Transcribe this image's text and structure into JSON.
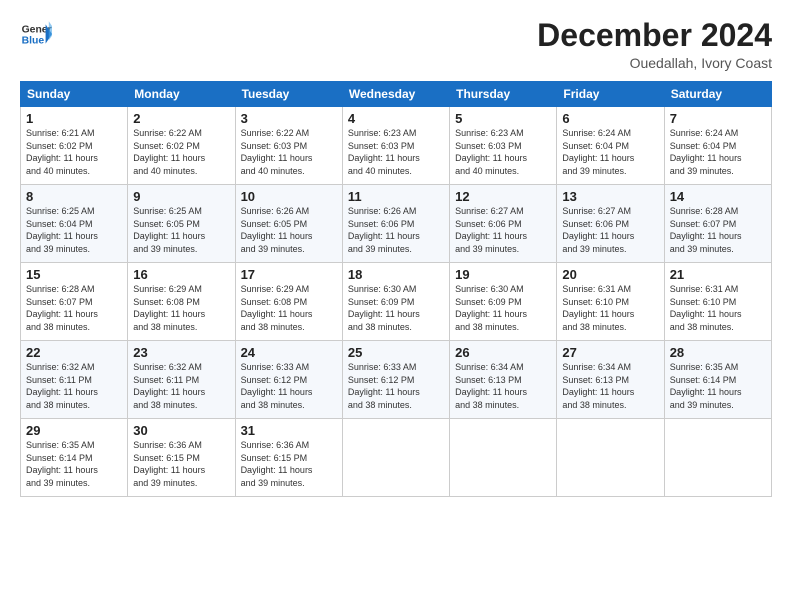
{
  "logo": {
    "line1": "General",
    "line2": "Blue"
  },
  "title": "December 2024",
  "subtitle": "Ouedallah, Ivory Coast",
  "header_days": [
    "Sunday",
    "Monday",
    "Tuesday",
    "Wednesday",
    "Thursday",
    "Friday",
    "Saturday"
  ],
  "weeks": [
    [
      {
        "day": "1",
        "lines": [
          "Sunrise: 6:21 AM",
          "Sunset: 6:02 PM",
          "Daylight: 11 hours",
          "and 40 minutes."
        ]
      },
      {
        "day": "2",
        "lines": [
          "Sunrise: 6:22 AM",
          "Sunset: 6:02 PM",
          "Daylight: 11 hours",
          "and 40 minutes."
        ]
      },
      {
        "day": "3",
        "lines": [
          "Sunrise: 6:22 AM",
          "Sunset: 6:03 PM",
          "Daylight: 11 hours",
          "and 40 minutes."
        ]
      },
      {
        "day": "4",
        "lines": [
          "Sunrise: 6:23 AM",
          "Sunset: 6:03 PM",
          "Daylight: 11 hours",
          "and 40 minutes."
        ]
      },
      {
        "day": "5",
        "lines": [
          "Sunrise: 6:23 AM",
          "Sunset: 6:03 PM",
          "Daylight: 11 hours",
          "and 40 minutes."
        ]
      },
      {
        "day": "6",
        "lines": [
          "Sunrise: 6:24 AM",
          "Sunset: 6:04 PM",
          "Daylight: 11 hours",
          "and 39 minutes."
        ]
      },
      {
        "day": "7",
        "lines": [
          "Sunrise: 6:24 AM",
          "Sunset: 6:04 PM",
          "Daylight: 11 hours",
          "and 39 minutes."
        ]
      }
    ],
    [
      {
        "day": "8",
        "lines": [
          "Sunrise: 6:25 AM",
          "Sunset: 6:04 PM",
          "Daylight: 11 hours",
          "and 39 minutes."
        ]
      },
      {
        "day": "9",
        "lines": [
          "Sunrise: 6:25 AM",
          "Sunset: 6:05 PM",
          "Daylight: 11 hours",
          "and 39 minutes."
        ]
      },
      {
        "day": "10",
        "lines": [
          "Sunrise: 6:26 AM",
          "Sunset: 6:05 PM",
          "Daylight: 11 hours",
          "and 39 minutes."
        ]
      },
      {
        "day": "11",
        "lines": [
          "Sunrise: 6:26 AM",
          "Sunset: 6:06 PM",
          "Daylight: 11 hours",
          "and 39 minutes."
        ]
      },
      {
        "day": "12",
        "lines": [
          "Sunrise: 6:27 AM",
          "Sunset: 6:06 PM",
          "Daylight: 11 hours",
          "and 39 minutes."
        ]
      },
      {
        "day": "13",
        "lines": [
          "Sunrise: 6:27 AM",
          "Sunset: 6:06 PM",
          "Daylight: 11 hours",
          "and 39 minutes."
        ]
      },
      {
        "day": "14",
        "lines": [
          "Sunrise: 6:28 AM",
          "Sunset: 6:07 PM",
          "Daylight: 11 hours",
          "and 39 minutes."
        ]
      }
    ],
    [
      {
        "day": "15",
        "lines": [
          "Sunrise: 6:28 AM",
          "Sunset: 6:07 PM",
          "Daylight: 11 hours",
          "and 38 minutes."
        ]
      },
      {
        "day": "16",
        "lines": [
          "Sunrise: 6:29 AM",
          "Sunset: 6:08 PM",
          "Daylight: 11 hours",
          "and 38 minutes."
        ]
      },
      {
        "day": "17",
        "lines": [
          "Sunrise: 6:29 AM",
          "Sunset: 6:08 PM",
          "Daylight: 11 hours",
          "and 38 minutes."
        ]
      },
      {
        "day": "18",
        "lines": [
          "Sunrise: 6:30 AM",
          "Sunset: 6:09 PM",
          "Daylight: 11 hours",
          "and 38 minutes."
        ]
      },
      {
        "day": "19",
        "lines": [
          "Sunrise: 6:30 AM",
          "Sunset: 6:09 PM",
          "Daylight: 11 hours",
          "and 38 minutes."
        ]
      },
      {
        "day": "20",
        "lines": [
          "Sunrise: 6:31 AM",
          "Sunset: 6:10 PM",
          "Daylight: 11 hours",
          "and 38 minutes."
        ]
      },
      {
        "day": "21",
        "lines": [
          "Sunrise: 6:31 AM",
          "Sunset: 6:10 PM",
          "Daylight: 11 hours",
          "and 38 minutes."
        ]
      }
    ],
    [
      {
        "day": "22",
        "lines": [
          "Sunrise: 6:32 AM",
          "Sunset: 6:11 PM",
          "Daylight: 11 hours",
          "and 38 minutes."
        ]
      },
      {
        "day": "23",
        "lines": [
          "Sunrise: 6:32 AM",
          "Sunset: 6:11 PM",
          "Daylight: 11 hours",
          "and 38 minutes."
        ]
      },
      {
        "day": "24",
        "lines": [
          "Sunrise: 6:33 AM",
          "Sunset: 6:12 PM",
          "Daylight: 11 hours",
          "and 38 minutes."
        ]
      },
      {
        "day": "25",
        "lines": [
          "Sunrise: 6:33 AM",
          "Sunset: 6:12 PM",
          "Daylight: 11 hours",
          "and 38 minutes."
        ]
      },
      {
        "day": "26",
        "lines": [
          "Sunrise: 6:34 AM",
          "Sunset: 6:13 PM",
          "Daylight: 11 hours",
          "and 38 minutes."
        ]
      },
      {
        "day": "27",
        "lines": [
          "Sunrise: 6:34 AM",
          "Sunset: 6:13 PM",
          "Daylight: 11 hours",
          "and 38 minutes."
        ]
      },
      {
        "day": "28",
        "lines": [
          "Sunrise: 6:35 AM",
          "Sunset: 6:14 PM",
          "Daylight: 11 hours",
          "and 39 minutes."
        ]
      }
    ],
    [
      {
        "day": "29",
        "lines": [
          "Sunrise: 6:35 AM",
          "Sunset: 6:14 PM",
          "Daylight: 11 hours",
          "and 39 minutes."
        ]
      },
      {
        "day": "30",
        "lines": [
          "Sunrise: 6:36 AM",
          "Sunset: 6:15 PM",
          "Daylight: 11 hours",
          "and 39 minutes."
        ]
      },
      {
        "day": "31",
        "lines": [
          "Sunrise: 6:36 AM",
          "Sunset: 6:15 PM",
          "Daylight: 11 hours",
          "and 39 minutes."
        ]
      },
      null,
      null,
      null,
      null
    ]
  ]
}
